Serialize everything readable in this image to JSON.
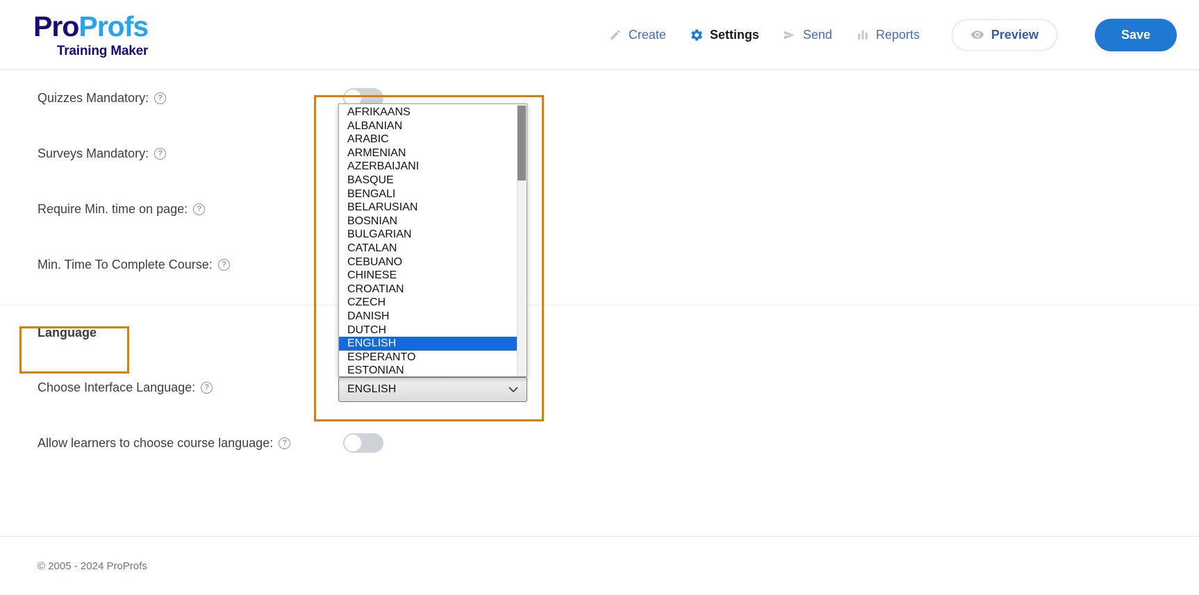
{
  "header": {
    "logo": {
      "part1": "Pro",
      "part2": "Profs",
      "subtitle": "Training Maker",
      "color_part1": "#1b0a75",
      "color_part2": "#27a3f0"
    },
    "nav": [
      {
        "label": "Create",
        "icon": "pencil-icon",
        "active": false
      },
      {
        "label": "Settings",
        "icon": "gear-icon",
        "active": true
      },
      {
        "label": "Send",
        "icon": "paper-plane-icon",
        "active": false
      },
      {
        "label": "Reports",
        "icon": "bar-chart-icon",
        "active": false
      }
    ],
    "preview_label": "Preview",
    "preview_icon": "eye-icon",
    "save_label": "Save",
    "save_color": "#1f78d1"
  },
  "settings": {
    "rows": [
      {
        "label": "Quizzes Mandatory:",
        "help": "?",
        "control": "toggle",
        "state": "off"
      },
      {
        "label": "Surveys Mandatory:",
        "help": "?",
        "control": "toggle",
        "state": "off"
      },
      {
        "label": "Require Min. time on page:",
        "help": "?",
        "control": "toggle",
        "state": "off"
      },
      {
        "label": "Min. Time To Complete Course:",
        "help": "?",
        "control": "toggle",
        "state": "off"
      }
    ]
  },
  "language_section": {
    "heading": "Language",
    "choose_label": "Choose Interface Language:",
    "choose_help": "?",
    "allow_label": "Allow learners to choose course language:",
    "allow_help": "?",
    "allow_state": "off",
    "select": {
      "value": "ENGLISH",
      "expanded": true,
      "chevron_icon": "chevron-down-icon",
      "options": [
        "AFRIKAANS",
        "ALBANIAN",
        "ARABIC",
        "ARMENIAN",
        "AZERBAIJANI",
        "BASQUE",
        "BENGALI",
        "BELARUSIAN",
        "BOSNIAN",
        "BULGARIAN",
        "CATALAN",
        "CEBUANO",
        "CHINESE",
        "CROATIAN",
        "CZECH",
        "DANISH",
        "DUTCH",
        "ENGLISH",
        "ESPERANTO",
        "ESTONIAN"
      ],
      "selected_option": "ENGLISH",
      "selected_bg": "#1568dd"
    }
  },
  "annotations": {
    "color": "#d97e09",
    "boxes": [
      {
        "name": "language-heading-highlight"
      },
      {
        "name": "language-dropdown-highlight"
      }
    ]
  },
  "footer": {
    "copyright": "© 2005 - 2024 ProProfs"
  }
}
